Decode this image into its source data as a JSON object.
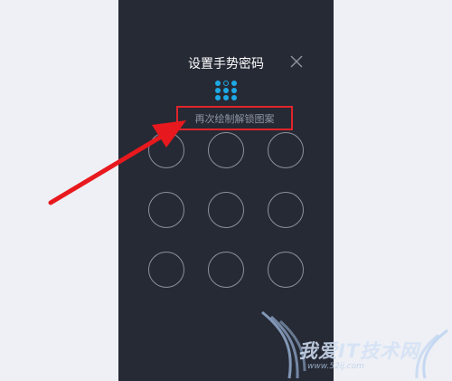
{
  "screen": {
    "title": "设置手势密码",
    "hint": "再次绘制解锁图案"
  },
  "icons": {
    "close": "close-icon",
    "preview": "pattern-preview-icon"
  },
  "preview_pattern": {
    "filled": [
      true,
      false,
      true,
      true,
      true,
      true,
      true,
      true,
      true
    ]
  },
  "watermark": {
    "text": "我爱IT技术网",
    "url": "www.52ij.com"
  },
  "colors": {
    "background": "#262a35",
    "accent": "#1ea9e6",
    "highlight_box": "#e0242a",
    "arrow": "#e8191e",
    "circle_stroke": "#8c919c"
  }
}
